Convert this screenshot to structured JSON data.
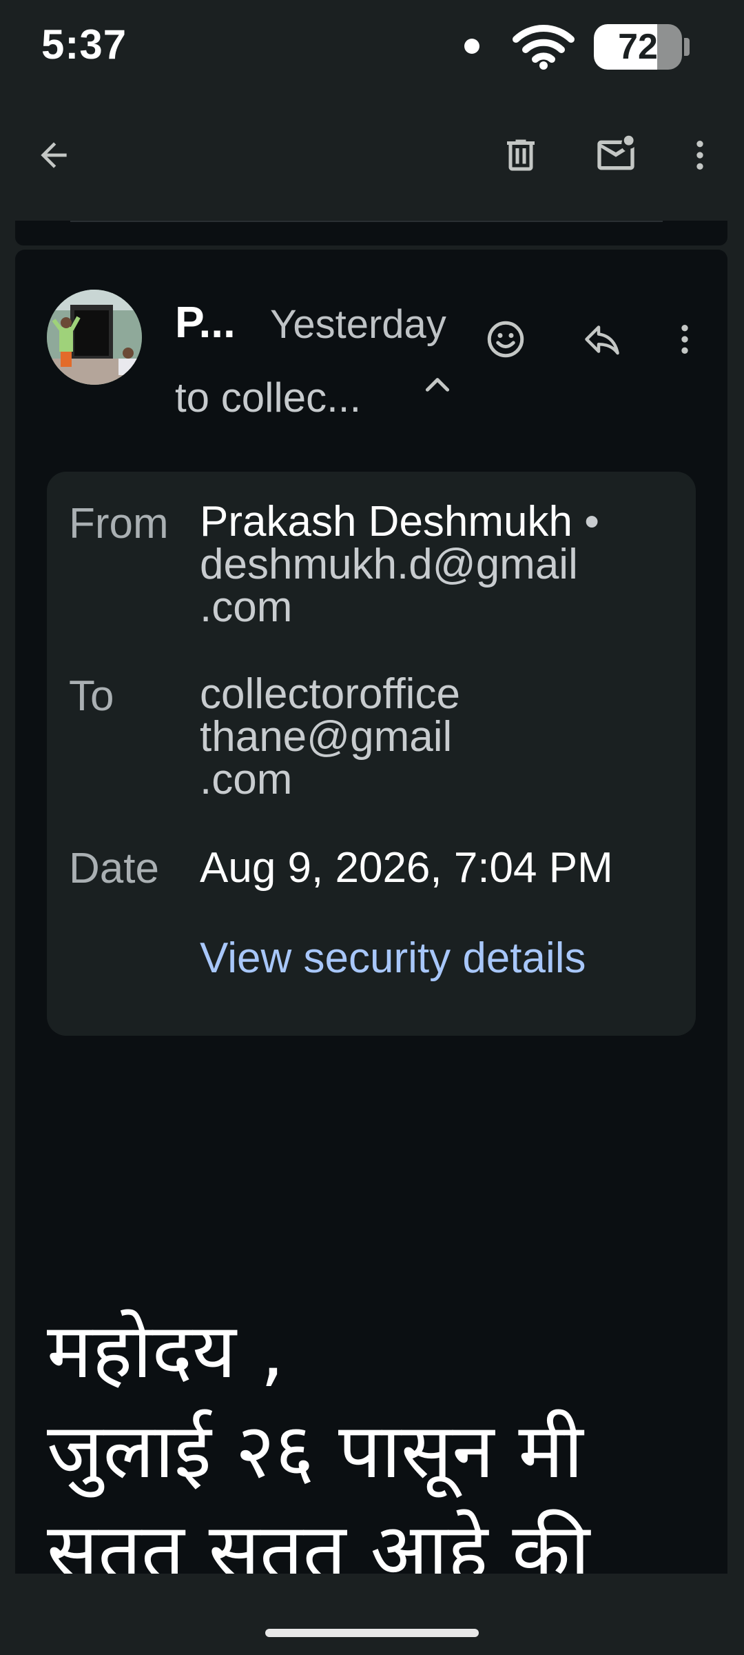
{
  "status_bar": {
    "time": "5:37",
    "battery_level": "72",
    "battery_fraction": 0.72
  },
  "toolbar": {
    "back_icon": "arrow-back-icon",
    "delete_icon": "trash-icon",
    "mark_unread_icon": "mark-unread-icon",
    "more_icon": "more-vert-icon"
  },
  "message": {
    "sender_short": "P...",
    "time_label": "Yesterday",
    "recipient_summary": "to collec...",
    "react_icon": "smiley-icon",
    "reply_icon": "reply-icon",
    "more_icon": "more-vert-icon",
    "details": {
      "from_label": "From",
      "from_name": "Prakash Deshmukh",
      "from_separator": "•",
      "from_email_line1": "deshmukh.d@gmail",
      "from_email_line2": ".com",
      "to_label": "To",
      "to_line1": "collectoroffice",
      "to_line2": "thane@gmail",
      "to_line3": ".com",
      "date_label": "Date",
      "date_value": "Aug 9, 2026, 7:04 PM",
      "security_link": "View security details"
    },
    "body_lines": [
      "महोदय ,",
      "जुलाई २६ पासून मी",
      "सतत सतत आहे की"
    ]
  },
  "colors": {
    "background": "#1b2021",
    "card": "#0b0f12",
    "details_panel": "#1a2021",
    "link": "#a8c7fa"
  }
}
